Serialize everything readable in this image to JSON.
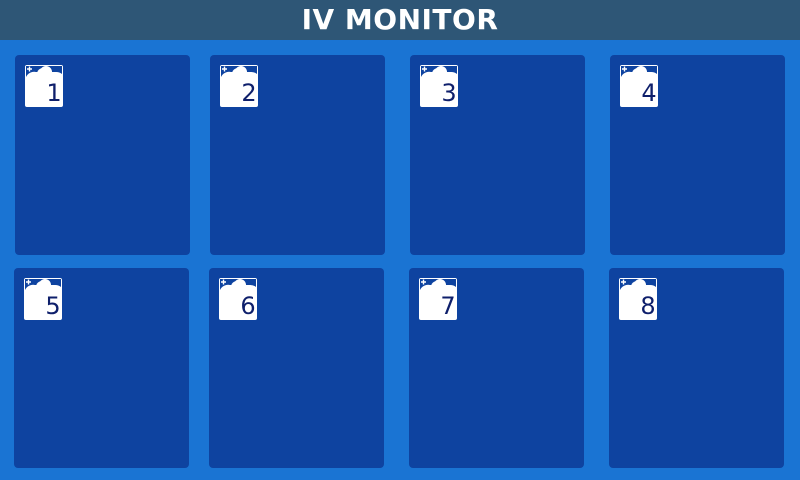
{
  "header": {
    "title": "IV MONITOR"
  },
  "beds": [
    {
      "number": "1",
      "icon": "add-patient-icon"
    },
    {
      "number": "2",
      "icon": "add-patient-icon"
    },
    {
      "number": "3",
      "icon": "add-patient-icon"
    },
    {
      "number": "4",
      "icon": "add-patient-icon"
    },
    {
      "number": "5",
      "icon": "add-patient-icon"
    },
    {
      "number": "6",
      "icon": "add-patient-icon"
    },
    {
      "number": "7",
      "icon": "add-patient-icon"
    },
    {
      "number": "8",
      "icon": "add-patient-icon"
    }
  ],
  "colors": {
    "background": "#1a74d3",
    "header": "#2e5676",
    "tile": "#0e43a0",
    "bed_number": "#0e1f6b"
  }
}
